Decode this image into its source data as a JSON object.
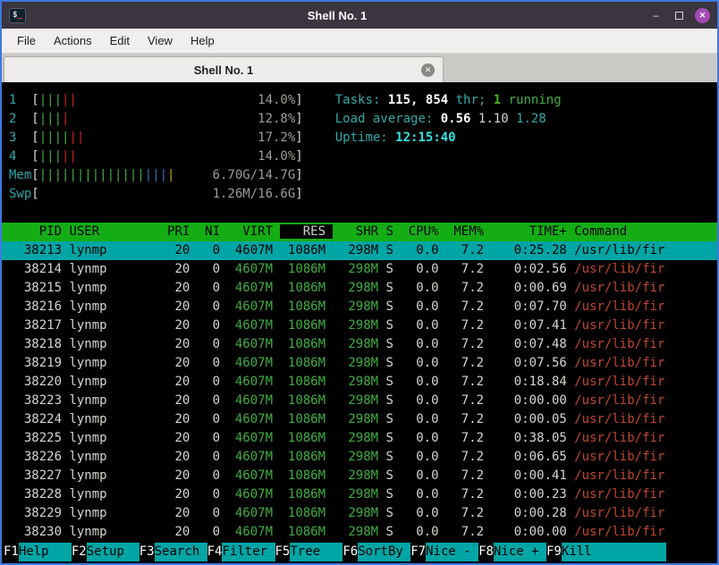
{
  "window": {
    "title": "Shell No. 1"
  },
  "menu": {
    "items": [
      "File",
      "Actions",
      "Edit",
      "View",
      "Help"
    ]
  },
  "tab": {
    "label": "Shell No. 1"
  },
  "htop": {
    "meters": [
      {
        "name": "cpu-meter-1",
        "label": "1",
        "value": "14.0%",
        "ticks": [
          [
            "green",
            3
          ],
          [
            "red",
            2
          ]
        ]
      },
      {
        "name": "cpu-meter-2",
        "label": "2",
        "value": "12.8%",
        "ticks": [
          [
            "green",
            3
          ],
          [
            "red",
            1
          ]
        ]
      },
      {
        "name": "cpu-meter-3",
        "label": "3",
        "value": "17.2%",
        "ticks": [
          [
            "green",
            4
          ],
          [
            "red",
            2
          ]
        ]
      },
      {
        "name": "cpu-meter-4",
        "label": "4",
        "value": "14.0%",
        "ticks": [
          [
            "green",
            3
          ],
          [
            "red",
            2
          ]
        ]
      },
      {
        "name": "memory-meter",
        "label": "Mem",
        "value": "6.70G/14.7G",
        "ticks": [
          [
            "green",
            14
          ],
          [
            "blue",
            3
          ],
          [
            "yellow",
            1
          ]
        ]
      },
      {
        "name": "swap-meter",
        "label": "Swp",
        "value": "1.26M/16.6G",
        "ticks": []
      }
    ],
    "tasks": {
      "label": "Tasks: ",
      "count": "115, ",
      "threads": "854 ",
      "thr_label": "thr; ",
      "running_count": "1 ",
      "running_label": "running"
    },
    "load": {
      "label": "Load average: ",
      "one": "0.56 ",
      "five": "1.10 ",
      "fifteen": "1.28"
    },
    "uptime": {
      "label": "Uptime: ",
      "value": "12:15:40"
    },
    "table": {
      "columns": [
        "PID",
        "USER",
        "PRI",
        "NI",
        "VIRT",
        "RES",
        "SHR",
        "S",
        "CPU%",
        "MEM%",
        "TIME+",
        "Command"
      ],
      "sort_column": "RES",
      "rows": [
        {
          "pid": "38213",
          "user": "lynmp",
          "pri": "20",
          "ni": "0",
          "virt": "4607M",
          "res": "1086M",
          "shr": "298M",
          "s": "S",
          "cpu": "0.0",
          "mem": "7.2",
          "time": "0:25.28",
          "command": "/usr/lib/fir",
          "selected": true
        },
        {
          "pid": "38214",
          "user": "lynmp",
          "pri": "20",
          "ni": "0",
          "virt": "4607M",
          "res": "1086M",
          "shr": "298M",
          "s": "S",
          "cpu": "0.0",
          "mem": "7.2",
          "time": "0:02.56",
          "command": "/usr/lib/fir",
          "selected": false
        },
        {
          "pid": "38215",
          "user": "lynmp",
          "pri": "20",
          "ni": "0",
          "virt": "4607M",
          "res": "1086M",
          "shr": "298M",
          "s": "S",
          "cpu": "0.0",
          "mem": "7.2",
          "time": "0:00.69",
          "command": "/usr/lib/fir",
          "selected": false
        },
        {
          "pid": "38216",
          "user": "lynmp",
          "pri": "20",
          "ni": "0",
          "virt": "4607M",
          "res": "1086M",
          "shr": "298M",
          "s": "S",
          "cpu": "0.0",
          "mem": "7.2",
          "time": "0:07.70",
          "command": "/usr/lib/fir",
          "selected": false
        },
        {
          "pid": "38217",
          "user": "lynmp",
          "pri": "20",
          "ni": "0",
          "virt": "4607M",
          "res": "1086M",
          "shr": "298M",
          "s": "S",
          "cpu": "0.0",
          "mem": "7.2",
          "time": "0:07.41",
          "command": "/usr/lib/fir",
          "selected": false
        },
        {
          "pid": "38218",
          "user": "lynmp",
          "pri": "20",
          "ni": "0",
          "virt": "4607M",
          "res": "1086M",
          "shr": "298M",
          "s": "S",
          "cpu": "0.0",
          "mem": "7.2",
          "time": "0:07.48",
          "command": "/usr/lib/fir",
          "selected": false
        },
        {
          "pid": "38219",
          "user": "lynmp",
          "pri": "20",
          "ni": "0",
          "virt": "4607M",
          "res": "1086M",
          "shr": "298M",
          "s": "S",
          "cpu": "0.0",
          "mem": "7.2",
          "time": "0:07.56",
          "command": "/usr/lib/fir",
          "selected": false
        },
        {
          "pid": "38220",
          "user": "lynmp",
          "pri": "20",
          "ni": "0",
          "virt": "4607M",
          "res": "1086M",
          "shr": "298M",
          "s": "S",
          "cpu": "0.0",
          "mem": "7.2",
          "time": "0:18.84",
          "command": "/usr/lib/fir",
          "selected": false
        },
        {
          "pid": "38223",
          "user": "lynmp",
          "pri": "20",
          "ni": "0",
          "virt": "4607M",
          "res": "1086M",
          "shr": "298M",
          "s": "S",
          "cpu": "0.0",
          "mem": "7.2",
          "time": "0:00.00",
          "command": "/usr/lib/fir",
          "selected": false
        },
        {
          "pid": "38224",
          "user": "lynmp",
          "pri": "20",
          "ni": "0",
          "virt": "4607M",
          "res": "1086M",
          "shr": "298M",
          "s": "S",
          "cpu": "0.0",
          "mem": "7.2",
          "time": "0:00.05",
          "command": "/usr/lib/fir",
          "selected": false
        },
        {
          "pid": "38225",
          "user": "lynmp",
          "pri": "20",
          "ni": "0",
          "virt": "4607M",
          "res": "1086M",
          "shr": "298M",
          "s": "S",
          "cpu": "0.0",
          "mem": "7.2",
          "time": "0:38.05",
          "command": "/usr/lib/fir",
          "selected": false
        },
        {
          "pid": "38226",
          "user": "lynmp",
          "pri": "20",
          "ni": "0",
          "virt": "4607M",
          "res": "1086M",
          "shr": "298M",
          "s": "S",
          "cpu": "0.0",
          "mem": "7.2",
          "time": "0:06.65",
          "command": "/usr/lib/fir",
          "selected": false
        },
        {
          "pid": "38227",
          "user": "lynmp",
          "pri": "20",
          "ni": "0",
          "virt": "4607M",
          "res": "1086M",
          "shr": "298M",
          "s": "S",
          "cpu": "0.0",
          "mem": "7.2",
          "time": "0:00.41",
          "command": "/usr/lib/fir",
          "selected": false
        },
        {
          "pid": "38228",
          "user": "lynmp",
          "pri": "20",
          "ni": "0",
          "virt": "4607M",
          "res": "1086M",
          "shr": "298M",
          "s": "S",
          "cpu": "0.0",
          "mem": "7.2",
          "time": "0:00.23",
          "command": "/usr/lib/fir",
          "selected": false
        },
        {
          "pid": "38229",
          "user": "lynmp",
          "pri": "20",
          "ni": "0",
          "virt": "4607M",
          "res": "1086M",
          "shr": "298M",
          "s": "S",
          "cpu": "0.0",
          "mem": "7.2",
          "time": "0:00.28",
          "command": "/usr/lib/fir",
          "selected": false
        },
        {
          "pid": "38230",
          "user": "lynmp",
          "pri": "20",
          "ni": "0",
          "virt": "4607M",
          "res": "1086M",
          "shr": "298M",
          "s": "S",
          "cpu": "0.0",
          "mem": "7.2",
          "time": "0:00.00",
          "command": "/usr/lib/fir",
          "selected": false
        }
      ]
    },
    "fkeys": [
      {
        "key": "F1",
        "label": "Help"
      },
      {
        "key": "F2",
        "label": "Setup"
      },
      {
        "key": "F3",
        "label": "Search"
      },
      {
        "key": "F4",
        "label": "Filter"
      },
      {
        "key": "F5",
        "label": "Tree"
      },
      {
        "key": "F6",
        "label": "SortBy"
      },
      {
        "key": "F7",
        "label": "Nice -"
      },
      {
        "key": "F8",
        "label": "Nice +"
      },
      {
        "key": "F9",
        "label": "Kill"
      }
    ]
  },
  "colors": {
    "window_border": "#3c78e0",
    "titlebar_bg": "#3a353e",
    "terminal_bg": "#000000",
    "terminal_fg": "#d3d7cf",
    "label_cyan": "#2fa8a8",
    "bright_cyan": "#34e2e2",
    "header_green_bg": "#14ad14",
    "value_green": "#3fae3f",
    "command_red": "#c0462c",
    "selection_cyan_bg": "#00a5a5",
    "tick_red": "#cc2222",
    "tick_blue": "#3d6fc2",
    "close_button_purple": "#a44bb4"
  }
}
